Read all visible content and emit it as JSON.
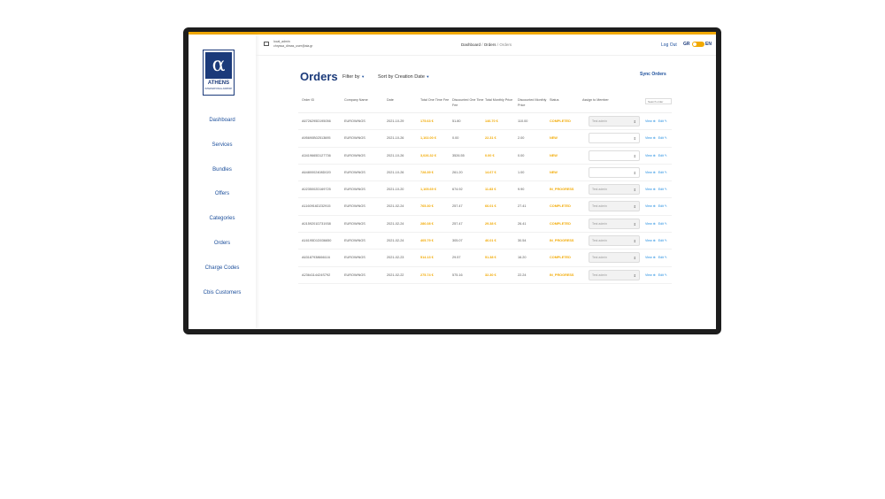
{
  "header": {
    "user_name": "local_admin",
    "user_email": "chryssa_dimas_user@aia.gr",
    "breadcrumb": [
      "Dashboard",
      "Orders",
      "Orders"
    ],
    "logout_label": "Log Out",
    "lang_gr": "GR",
    "lang_en": "EN"
  },
  "logo": {
    "mark": "α",
    "name": "ATHENS",
    "sub": "INTERNATIONAL AIRPORT"
  },
  "sidebar": {
    "items": [
      {
        "label": "Dashboard"
      },
      {
        "label": "Services"
      },
      {
        "label": "Bundles"
      },
      {
        "label": "Offers"
      },
      {
        "label": "Categories"
      },
      {
        "label": "Orders"
      },
      {
        "label": "Charge Codes"
      },
      {
        "label": "Cbis Customers"
      }
    ]
  },
  "page": {
    "title": "Orders",
    "filter_label": "Filter by",
    "sort_label": "Sort by Creation Date",
    "sync_label": "Sync Orders",
    "search_placeholder": "Search order"
  },
  "table": {
    "headers": {
      "order_id": "Order ID",
      "company": "Company Name",
      "date": "Date",
      "total_one_time": "Total One Time Fee",
      "discounted_one_time": "Discounted One Time Fee",
      "total_monthly": "Total Monthly Price",
      "discounted_monthly": "Discounted Monthly Price",
      "status": "Status",
      "assign": "Assign to Member"
    },
    "view_label": "View ⊕",
    "edit_label": "Edit ✎",
    "rows": [
      {
        "id": "A6726295D195056",
        "company": "EUROWINGS",
        "date": "2021-10-29",
        "total_one": "175.63 €",
        "disc_one": "51.80",
        "total_monthly": "146.70 €",
        "disc_monthly": "110.00",
        "status": "COMPLETED",
        "assign": "Test admin",
        "filled": true
      },
      {
        "id": "A95690B02513695",
        "company": "EUROWINGS",
        "date": "2021-10-26",
        "total_one": "1,102.00 €",
        "disc_one": "0.00",
        "total_monthly": "22.31 €",
        "disc_monthly": "2.00",
        "status": "NEW",
        "assign": "",
        "filled": false
      },
      {
        "id": "A3419665D127736",
        "company": "EUROWINGS",
        "date": "2021-10-26",
        "total_one": "3,026.32 €",
        "disc_one": "3526.55",
        "total_monthly": "0.00 €",
        "disc_monthly": "0.00",
        "status": "NEW",
        "assign": "",
        "filled": false
      },
      {
        "id": "A6480002408D020",
        "company": "EUROWINGS",
        "date": "2021-10-26",
        "total_one": "728.39 €",
        "disc_one": "261.20",
        "total_monthly": "14.67 €",
        "disc_monthly": "1.00",
        "status": "NEW",
        "assign": "",
        "filled": false
      },
      {
        "id": "A0235002D169725",
        "company": "EUROWINGS",
        "date": "2021-10-20",
        "total_one": "1,105.69 €",
        "disc_one": "674.92",
        "total_monthly": "11.83 €",
        "disc_monthly": "9.90",
        "status": "IN_PROGRESS",
        "assign": "Test admin",
        "filled": true
      },
      {
        "id": "A1160916D232915",
        "company": "EUROWINGS",
        "date": "2021-02-24",
        "total_one": "765.30 €",
        "disc_one": "257.47",
        "total_monthly": "66.01 €",
        "disc_monthly": "27.41",
        "status": "COMPLETED",
        "assign": "Test admin",
        "filled": true
      },
      {
        "id": "A0159201D731938",
        "company": "EUROWINGS",
        "date": "2021-02-24",
        "total_one": "286.08 €",
        "disc_one": "257.47",
        "total_monthly": "29.38 €",
        "disc_monthly": "26.41",
        "status": "COMPLETED",
        "assign": "Test admin",
        "filled": true
      },
      {
        "id": "A16195D1D036650",
        "company": "EUROWINGS",
        "date": "2021-02-24",
        "total_one": "405.79 €",
        "disc_one": "305.07",
        "total_monthly": "46.01 €",
        "disc_monthly": "30.54",
        "status": "IN_PROGRESS",
        "assign": "Test admin",
        "filled": true
      },
      {
        "id": "A63187938666116",
        "company": "EUROWINGS",
        "date": "2021-02-23",
        "total_one": "514.13 €",
        "disc_one": "29.57",
        "total_monthly": "51.38 €",
        "disc_monthly": "16.20",
        "status": "COMPLETED",
        "assign": "Test admin",
        "filled": true
      },
      {
        "id": "A2364114424S792",
        "company": "EUROWINGS",
        "date": "2021-02-22",
        "total_one": "275.74 €",
        "disc_one": "575.16",
        "total_monthly": "32.30 €",
        "disc_monthly": "22.24",
        "status": "IN_PROGRESS",
        "assign": "Test admin",
        "filled": true
      }
    ]
  },
  "colors": {
    "accent": "#f2a900",
    "brand": "#1b3a7a",
    "link": "#1b8ae0"
  }
}
